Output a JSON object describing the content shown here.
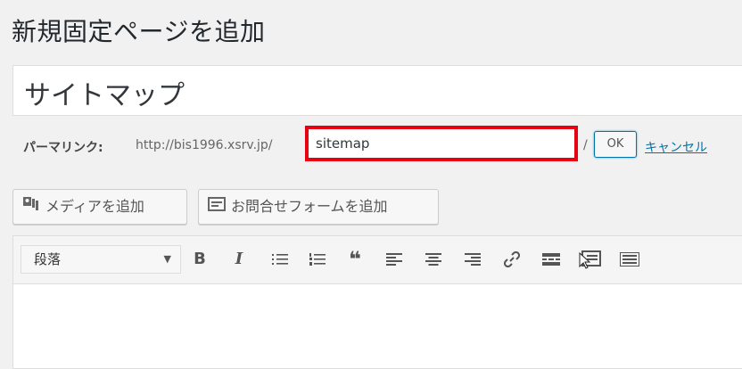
{
  "page": {
    "title": "新規固定ページを追加"
  },
  "post_title": {
    "value": "サイトマップ"
  },
  "permalink": {
    "label": "パーマリンク:",
    "base_url": "http://bis1996.xsrv.jp/",
    "slug": "sitemap",
    "slash": "/",
    "ok_label": "OK",
    "cancel_label": "キャンセル"
  },
  "media_buttons": {
    "add_media": "メディアを追加",
    "add_form": "お問合せフォームを追加"
  },
  "toolbar": {
    "format_value": "段落",
    "buttons": [
      "bold",
      "italic",
      "bullet-list",
      "numbered-list",
      "blockquote",
      "align-left",
      "align-center",
      "align-right",
      "link",
      "read-more",
      "toolbar-toggle",
      "keyboard"
    ]
  },
  "colors": {
    "highlight": "#e60012",
    "link": "#0073aa"
  }
}
